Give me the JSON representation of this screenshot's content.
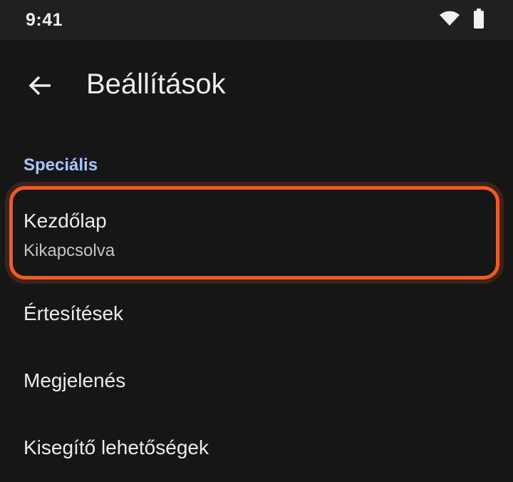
{
  "status_bar": {
    "time": "9:41",
    "icons": [
      "wifi-icon",
      "battery-icon"
    ]
  },
  "toolbar": {
    "back_icon": "arrow-back-icon",
    "title": "Beállítások"
  },
  "section": {
    "header": "Speciális"
  },
  "settings": {
    "items": [
      {
        "title": "Kezdőlap",
        "summary": "Kikapcsolva",
        "highlighted": true
      },
      {
        "title": "Értesítések"
      },
      {
        "title": "Megjelenés"
      },
      {
        "title": "Kisegítő lehetőségek"
      }
    ]
  },
  "colors": {
    "background": "#161616",
    "status_bar": "#202020",
    "accent_header": "#a9c7ff",
    "highlight": "#f15a24"
  }
}
